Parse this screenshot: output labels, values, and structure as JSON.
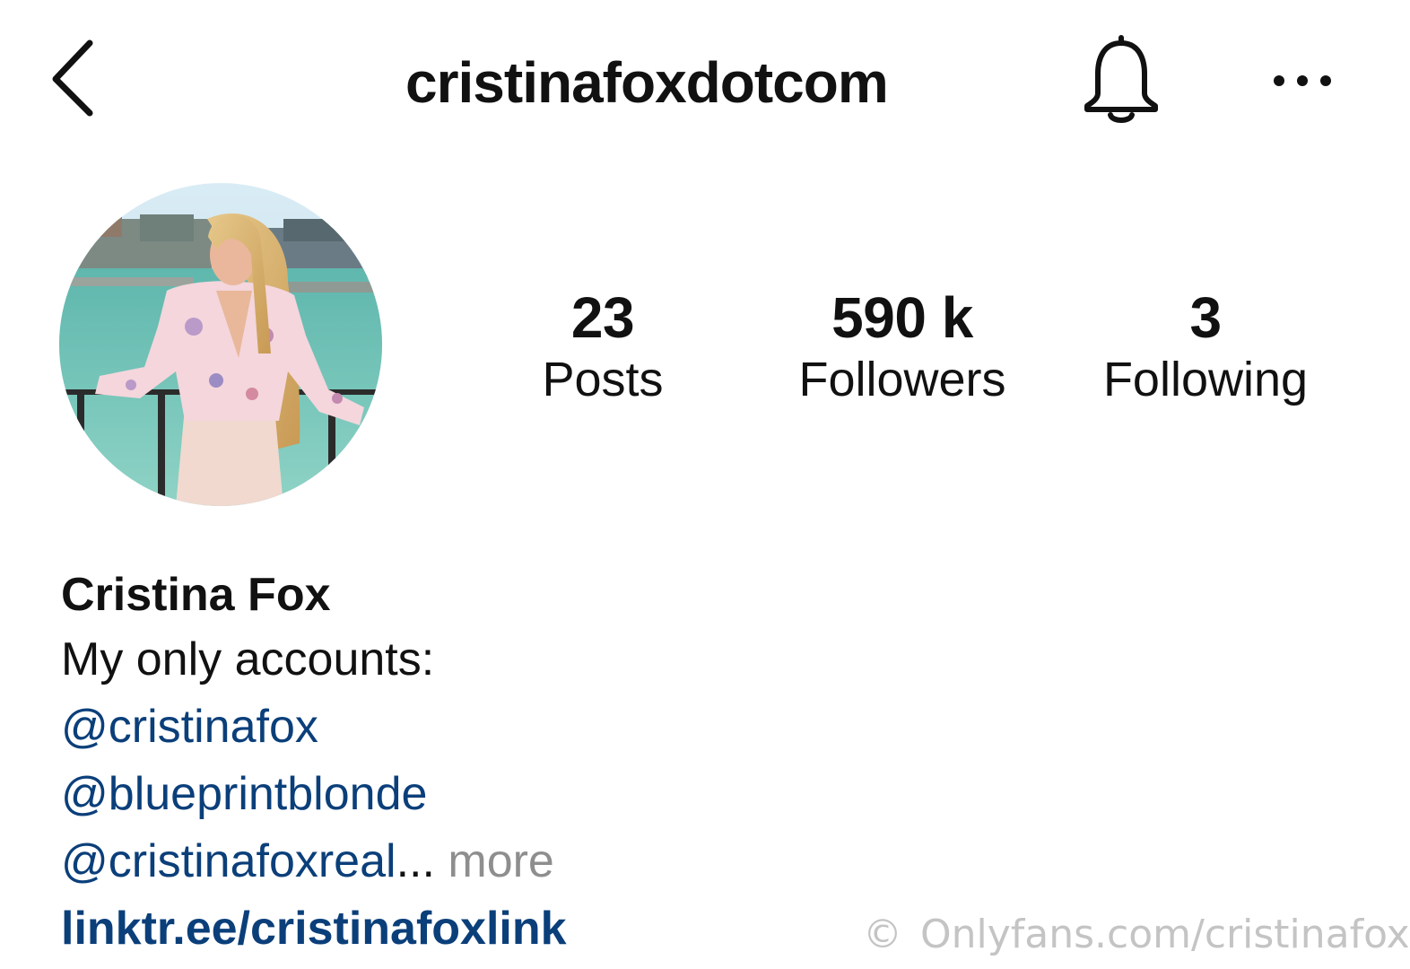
{
  "header": {
    "username": "cristinafoxdotcom",
    "back_icon": "chevron-left-icon",
    "bell_icon": "bell-icon",
    "more_icon": "ellipsis-icon"
  },
  "profile": {
    "stats": {
      "posts": {
        "value": "23",
        "label": "Posts"
      },
      "followers": {
        "value": "590 k",
        "label": "Followers"
      },
      "following": {
        "value": "3",
        "label": "Following"
      }
    },
    "bio": {
      "name": "Cristina Fox",
      "line1": "My only accounts:",
      "mention1": "@cristinafox",
      "mention2": "@blueprintblonde",
      "mention3": "@cristinafoxreal",
      "ellipsis": "...",
      "more": "more",
      "link": "linktr.ee/cristinafoxlink"
    }
  },
  "watermark": {
    "symbol": "©",
    "text": "Onlyfans.com/cristinafox"
  },
  "colors": {
    "link": "#0b3f7a",
    "more": "#8e8e8e",
    "watermark": "#c4c4c4",
    "text": "#111111"
  }
}
